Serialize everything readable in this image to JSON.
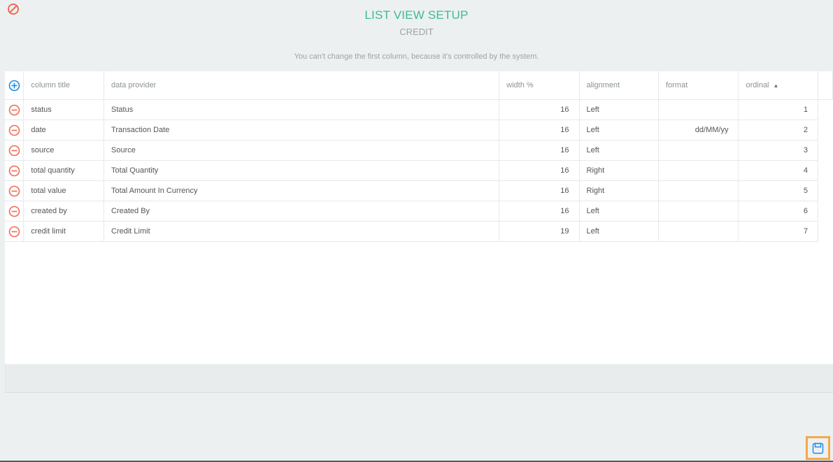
{
  "header": {
    "title": "LIST VIEW SETUP",
    "subtitle": "CREDIT"
  },
  "note": "You can't change the first column, because it's controlled by the system.",
  "table": {
    "columns": {
      "column_title": "column title",
      "data_provider": "data provider",
      "width": "width %",
      "alignment": "alignment",
      "format": "format",
      "ordinal": "ordinal"
    },
    "sorted_by": "ordinal",
    "rows": [
      {
        "title": "status",
        "provider": "Status",
        "width": "16",
        "alignment": "Left",
        "format": "",
        "ordinal": "1"
      },
      {
        "title": "date",
        "provider": "Transaction Date",
        "width": "16",
        "alignment": "Left",
        "format": "dd/MM/yy",
        "ordinal": "2"
      },
      {
        "title": "source",
        "provider": "Source",
        "width": "16",
        "alignment": "Left",
        "format": "",
        "ordinal": "3"
      },
      {
        "title": "total quantity",
        "provider": "Total Quantity",
        "width": "16",
        "alignment": "Right",
        "format": "",
        "ordinal": "4"
      },
      {
        "title": "total value",
        "provider": "Total Amount In Currency",
        "width": "16",
        "alignment": "Right",
        "format": "",
        "ordinal": "5"
      },
      {
        "title": "created by",
        "provider": "Created By",
        "width": "16",
        "alignment": "Left",
        "format": "",
        "ordinal": "6"
      },
      {
        "title": "credit limit",
        "provider": "Credit Limit",
        "width": "19",
        "alignment": "Left",
        "format": "",
        "ordinal": "7"
      }
    ]
  },
  "icons": {
    "cancel": "cancel-icon",
    "add": "plus-circle-icon",
    "remove": "minus-circle-icon",
    "save": "save-icon",
    "sort": "sort-ascending-icon"
  },
  "colors": {
    "title": "#3dbb8f",
    "add_icon": "#1e88e5",
    "remove_icon": "#ef6b55",
    "cancel_icon": "#ef6b55",
    "save_highlight": "#f4a84a",
    "save_icon": "#1e88e5"
  }
}
